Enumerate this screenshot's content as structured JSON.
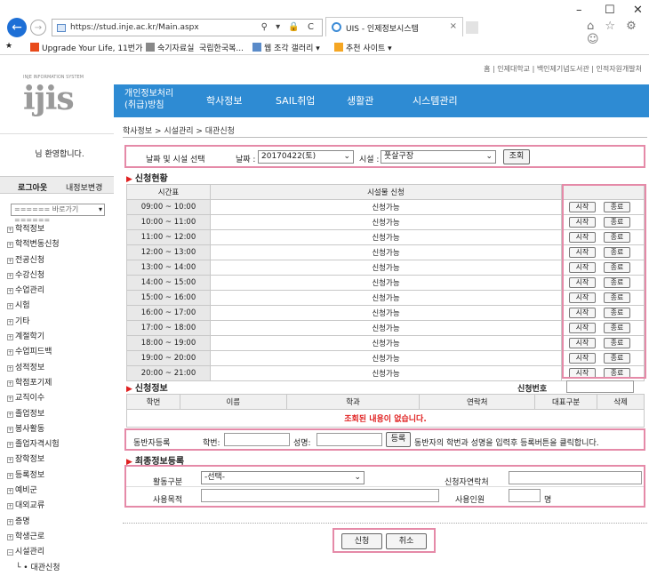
{
  "browser": {
    "url": "https://stud.inje.ac.kr/Main.aspx",
    "address_icons": "⚲ ▾ 🔒 C",
    "tab_title": "UIS - 인제정보시스템",
    "favorites": [
      "Upgrade Your Life, 11번가",
      "숙기자료실",
      "국립한국복...",
      "웹 조각 갤러리 ▾",
      "추천 사이트 ▾"
    ],
    "window_controls": [
      "–",
      "☐",
      "✕"
    ],
    "right_icons": "⌂ ☆ ⚙ ☺"
  },
  "header": {
    "top_links": "홈 | 인제대학교 | 백인제기념도서관 | 인적자원개발처",
    "logo_subtitle": "INJE INFORMATION SYSTEM",
    "logo_text": "ijis",
    "nav": [
      "개인정보처리\n(취급)방침",
      "학사정보",
      "SAIL취업",
      "생활관",
      "시스템관리"
    ]
  },
  "left": {
    "welcome": "님 환영합니다.",
    "logout": "로그아웃",
    "my_info": "내정보변경",
    "quick_select": "====== 바로가기 ======",
    "menu": [
      "학적정보",
      "학적변동신청",
      "전공신청",
      "수강신청",
      "수업관리",
      "시험",
      "기타",
      "계절학기",
      "수업피드백",
      "성적정보",
      "학점포기제",
      "교직이수",
      "졸업정보",
      "봉사활동",
      "졸업자격시험",
      "장학정보",
      "등록정보",
      "예비군",
      "대외교류",
      "증명",
      "학생근로",
      "시설관리"
    ],
    "submenu": "대관신청"
  },
  "breadcrumb": "학사정보 > 시설관리 > 대관신청",
  "search": {
    "label": "날짜 및 시설 선택",
    "date_label": "날짜 :",
    "date_value": "20170422(토)",
    "facility_label": "시설 :",
    "facility_value": "풋살구장",
    "button": "조회"
  },
  "schedule": {
    "title": "신청현황",
    "col_time": "시간표",
    "col_request": "시설물 신청",
    "start_label": "시작",
    "end_label": "종료",
    "rows": [
      {
        "time": "09:00 ~ 10:00",
        "status": "신청가능"
      },
      {
        "time": "10:00 ~ 11:00",
        "status": "신청가능"
      },
      {
        "time": "11:00 ~ 12:00",
        "status": "신청가능"
      },
      {
        "time": "12:00 ~ 13:00",
        "status": "신청가능"
      },
      {
        "time": "13:00 ~ 14:00",
        "status": "신청가능"
      },
      {
        "time": "14:00 ~ 15:00",
        "status": "신청가능"
      },
      {
        "time": "15:00 ~ 16:00",
        "status": "신청가능"
      },
      {
        "time": "16:00 ~ 17:00",
        "status": "신청가능"
      },
      {
        "time": "17:00 ~ 18:00",
        "status": "신청가능"
      },
      {
        "time": "18:00 ~ 19:00",
        "status": "신청가능"
      },
      {
        "time": "19:00 ~ 20:00",
        "status": "신청가능"
      },
      {
        "time": "20:00 ~ 21:00",
        "status": "신청가능"
      }
    ]
  },
  "application": {
    "title": "신청정보",
    "number_label": "신청번호",
    "columns": [
      "학번",
      "이름",
      "학과",
      "연락처",
      "대표구분",
      "삭제"
    ],
    "empty_message": "조회된 내용이 없습니다."
  },
  "companion": {
    "label": "동반자등록",
    "id_label": "학번:",
    "name_label": "성명:",
    "button": "등록",
    "hint": "동반자의 학번과 성명을 입력후 등록버튼을 클릭합니다."
  },
  "final": {
    "title": "최종정보등록",
    "activity_label": "활동구분",
    "activity_value": "-선택-",
    "contact_label": "신청자연락처",
    "purpose_label": "사용목적",
    "people_label": "사용인원",
    "people_unit": "명"
  },
  "actions": {
    "submit": "신청",
    "cancel": "취소"
  }
}
